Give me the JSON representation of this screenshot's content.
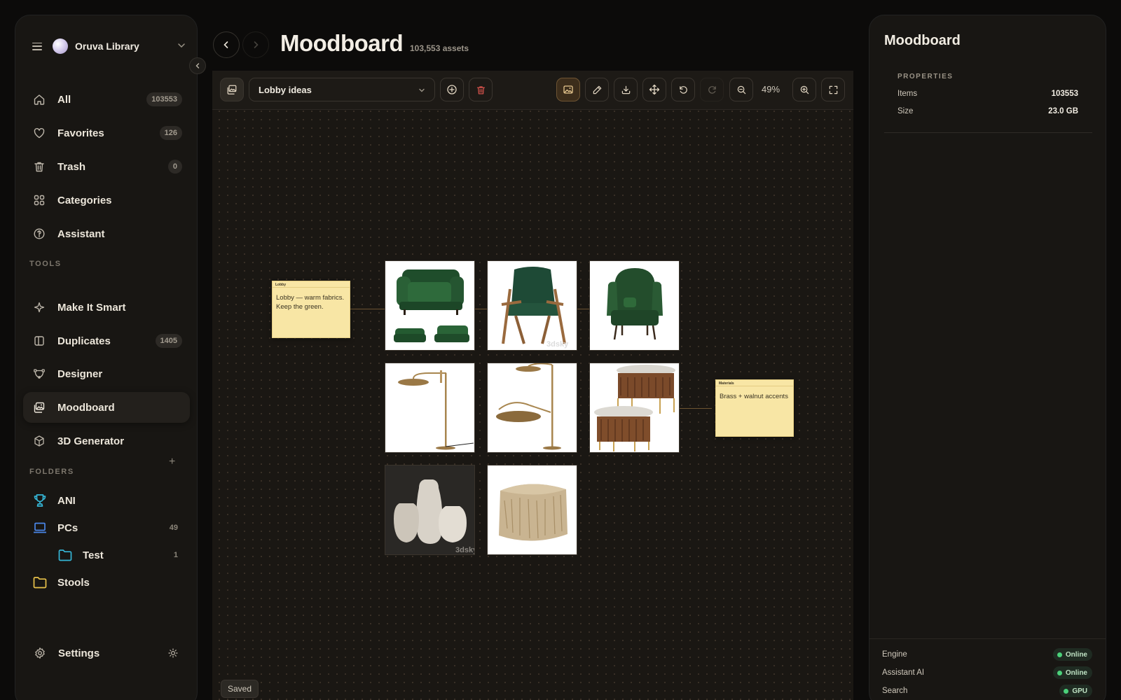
{
  "sidebar": {
    "library_name": "Oruva Library",
    "nav": [
      {
        "label": "All",
        "badge": "103553",
        "icon": "home-icon"
      },
      {
        "label": "Favorites",
        "badge": "126",
        "icon": "heart-icon"
      },
      {
        "label": "Trash",
        "badge": "0",
        "icon": "trash-icon"
      },
      {
        "label": "Categories",
        "badge": "",
        "icon": "grid-icon"
      },
      {
        "label": "Assistant",
        "badge": "",
        "icon": "assistant-icon"
      }
    ],
    "tools_title": "TOOLS",
    "tools": [
      {
        "label": "Make It Smart",
        "badge": "",
        "icon": "sparkle-icon"
      },
      {
        "label": "Duplicates",
        "badge": "1405",
        "icon": "duplicate-icon"
      },
      {
        "label": "Designer",
        "badge": "",
        "icon": "bezier-icon"
      },
      {
        "label": "Moodboard",
        "badge": "",
        "icon": "moodboard-icon",
        "active": true
      },
      {
        "label": "3D Generator",
        "badge": "",
        "icon": "cube-icon"
      }
    ],
    "folders_title": "FOLDERS",
    "folders": [
      {
        "label": "ANI",
        "count": "",
        "icon": "trophy-icon",
        "color": "#35b6d6"
      },
      {
        "label": "PCs",
        "count": "49",
        "icon": "laptop-icon",
        "color": "#4a86e8"
      },
      {
        "label": "Test",
        "count": "1",
        "icon": "folder-icon",
        "color": "#35b6d6"
      },
      {
        "label": "Stools",
        "count": "",
        "icon": "folder-icon",
        "color": "#e8c24a"
      }
    ],
    "settings_label": "Settings"
  },
  "header": {
    "title": "Moodboard",
    "subtitle": "103,553 assets"
  },
  "toolbar": {
    "board_name": "Lobby ideas",
    "zoom": "49%"
  },
  "board": {
    "notes": [
      {
        "title": "Lobby",
        "text": "Lobby — warm fabrics. Keep the green."
      },
      {
        "title": "Materials",
        "text": "Brass + walnut accents"
      }
    ],
    "tiles": [
      {
        "name": "green-velvet-armchair-set"
      },
      {
        "name": "green-mid-century-lounge-chair"
      },
      {
        "name": "green-wingback-chair"
      },
      {
        "name": "brass-floor-lamp"
      },
      {
        "name": "brass-double-floor-lamp"
      },
      {
        "name": "walnut-coffee-tables"
      },
      {
        "name": "ceramic-vases"
      },
      {
        "name": "shag-pouf"
      }
    ],
    "watermark": "3dsky",
    "save_status": "Saved"
  },
  "inspector": {
    "title": "Moodboard",
    "section": "PROPERTIES",
    "properties": [
      {
        "key": "Items",
        "value": "103553"
      },
      {
        "key": "Size",
        "value": "23.0 GB"
      }
    ],
    "status": [
      {
        "key": "Engine",
        "value": "Online"
      },
      {
        "key": "Assistant AI",
        "value": "Online"
      },
      {
        "key": "Search",
        "value": "GPU"
      }
    ]
  },
  "colors": {
    "accent": "#c9a46a",
    "status_online": "#4bd17a",
    "note": "#f8e6a5"
  }
}
